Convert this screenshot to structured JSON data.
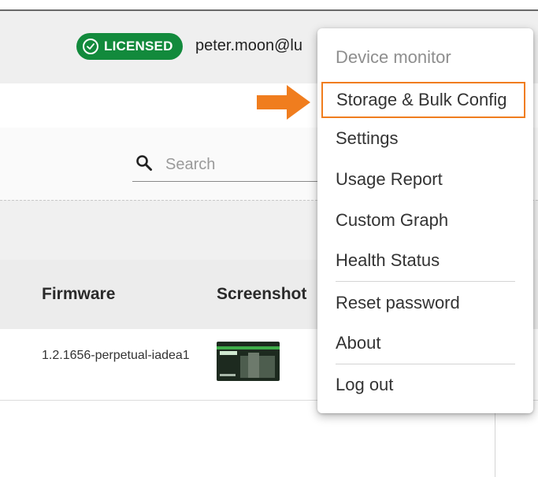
{
  "header": {
    "license_badge": "LICENSED",
    "user_email": "peter.moon@lu"
  },
  "search": {
    "placeholder": "Search"
  },
  "table": {
    "columns": [
      "Firmware",
      "Screenshot"
    ],
    "rows": [
      {
        "firmware": "1.2.1656-perpetual-iadea1"
      }
    ]
  },
  "menu": {
    "items": [
      {
        "label": "Device monitor",
        "disabled": true
      },
      {
        "label": "Storage & Bulk Config",
        "highlighted": true
      },
      {
        "label": "Settings"
      },
      {
        "label": "Usage Report"
      },
      {
        "label": "Custom Graph"
      },
      {
        "label": "Health Status"
      },
      {
        "label": "Reset password"
      },
      {
        "label": "About"
      },
      {
        "label": "Log out"
      }
    ]
  },
  "colors": {
    "license_green": "#128a3c",
    "highlight_orange": "#f07d1e",
    "arrow_orange": "#f07d1e"
  },
  "icons": {
    "license_check": "check-circle-icon",
    "search": "search-icon",
    "pointer": "arrow-right-icon"
  }
}
